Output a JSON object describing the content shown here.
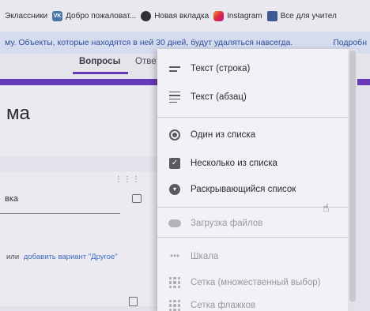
{
  "bookmarks": [
    {
      "label": "Одноклассники",
      "display": "Эклассники",
      "icon": "none"
    },
    {
      "label": "Добро пожаловат...",
      "icon": "vk-icon"
    },
    {
      "label": "Новая вкладка",
      "icon": "globe-icon"
    },
    {
      "label": "Instagram",
      "icon": "instagram-icon"
    },
    {
      "label": "Все для учител",
      "icon": "book-icon"
    }
  ],
  "infobar": {
    "text": "му. Объекты, которые находятся в ней 30 дней, будут удаляться навсегда.",
    "more_link": "Подробн"
  },
  "tabs": {
    "questions": "Вопросы",
    "answers": "Отве"
  },
  "form": {
    "title_partial": "ма",
    "question_placeholder": "вка",
    "or_text": "или",
    "add_other": "добавить вариант \"Другое\""
  },
  "menu": {
    "items": [
      {
        "label": "Текст (строка)",
        "icon": "short-text-icon"
      },
      {
        "label": "Текст (абзац)",
        "icon": "paragraph-icon"
      },
      {
        "label": "Один из списка",
        "icon": "radio-icon"
      },
      {
        "label": "Несколько из списка",
        "icon": "checkbox-icon"
      },
      {
        "label": "Раскрывающийся список",
        "icon": "dropdown-icon"
      },
      {
        "label": "Загрузка файлов",
        "icon": "cloud-upload-icon"
      },
      {
        "label": "Шкала",
        "icon": "scale-icon"
      },
      {
        "label": "Сетка (множественный выбор)",
        "icon": "grid-icon"
      },
      {
        "label": "Сетка флажков",
        "icon": "checkbox-grid-icon"
      }
    ]
  }
}
